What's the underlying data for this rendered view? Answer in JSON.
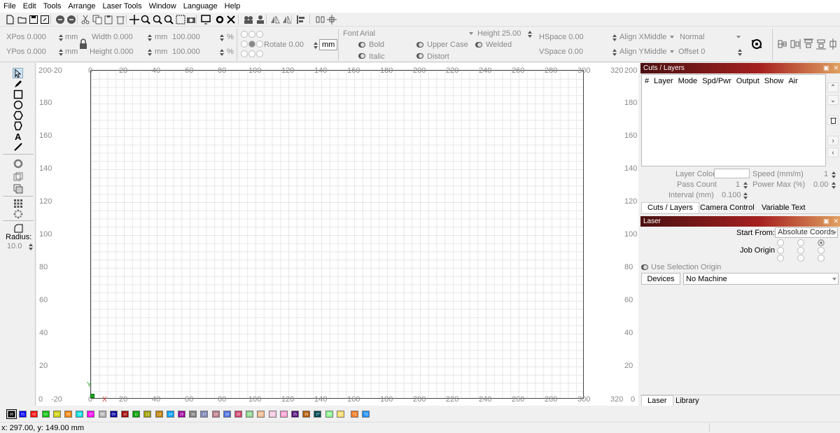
{
  "menu": [
    "File",
    "Edit",
    "Tools",
    "Arrange",
    "Laser Tools",
    "Window",
    "Language",
    "Help"
  ],
  "toolbar_icons": [
    "new-file-icon",
    "open-file-icon",
    "save-icon",
    "save-as-icon",
    "undo-icon",
    "redo-icon",
    "cut-icon",
    "copy-icon",
    "paste-icon",
    "delete-icon",
    "move-icon",
    "zoom-in-icon",
    "zoom-out-icon",
    "zoom-frame-icon",
    "zoom-fit-icon",
    "camera-icon",
    "monitor-icon",
    "settings-icon",
    "tools-icon",
    "group-icon",
    "user-icon",
    "mirror-h-icon",
    "mirror-v-icon",
    "align-icon",
    "distribute-icon",
    "center-icon"
  ],
  "props": {
    "xpos": "XPos 0.000",
    "ypos": "YPos 0.000",
    "unit_mm": "mm",
    "width": "Width 0.000",
    "height": "Height 0.000",
    "width_pct": "100.000",
    "height_pct": "100.000",
    "pct": "%",
    "rotate": "Rotate 0.00",
    "rotate_unit": "mm",
    "font_label": "Font",
    "font_value": "Arial",
    "font_height": "Height 25.00",
    "bold": "Bold",
    "italic": "Italic",
    "upper_case": "Upper Case",
    "distort": "Distort",
    "welded": "Welded",
    "hspace": "HSpace 0.00",
    "vspace": "VSpace 0.00",
    "align_x": "Align X",
    "align_x_value": "Middle",
    "align_y": "Align Y",
    "align_y_value": "Middle",
    "mode_value": "Normal",
    "offset": "Offset 0"
  },
  "left_tools": {
    "icons": [
      "select-arrow-icon",
      "pencil-icon",
      "rectangle-icon",
      "ellipse-icon",
      "polygon-icon",
      "pentagon-icon",
      "text-icon",
      "measure-icon",
      "circle-gear-icon",
      "offset-icon",
      "boolean-icon",
      "grid-array-icon",
      "circular-array-icon",
      "corner-icon"
    ],
    "radius_label": "Radius:",
    "radius_value": "10.0"
  },
  "ruler": {
    "x_top": [
      "-20",
      "0",
      "20",
      "40",
      "60",
      "80",
      "100",
      "120",
      "140",
      "160",
      "180",
      "200",
      "220",
      "240",
      "260",
      "280",
      "300",
      "320"
    ],
    "y_left": [
      "200",
      "180",
      "160",
      "140",
      "120",
      "100",
      "80",
      "60",
      "40",
      "20",
      "0"
    ],
    "corner_top_left": "200",
    "corner_top_right": "200",
    "corner_bottom_right": "0",
    "axis_x": "X",
    "axis_y": "Y"
  },
  "cuts_layers": {
    "title": "Cuts / Layers",
    "columns": [
      "#",
      "Layer",
      "Mode",
      "Spd/Pwr",
      "Output",
      "Show",
      "Air"
    ],
    "layer_color_label": "Layer Color",
    "speed_label": "Speed (mm/m)",
    "speed_value": "1",
    "pass_count_label": "Pass Count",
    "pass_count_value": "1",
    "power_max_label": "Power Max (%)",
    "power_max_value": "0.00",
    "interval_label": "Interval (mm)",
    "interval_value": "0.100",
    "tabs": [
      "Cuts / Layers",
      "Camera Control",
      "Variable Text"
    ]
  },
  "laser": {
    "title": "Laser",
    "start_from_label": "Start From:",
    "start_from_value": "Absolute Coords",
    "job_origin_label": "Job Origin",
    "use_selection_origin": "Use Selection Origin",
    "devices_button": "Devices",
    "machine_value": "No Machine",
    "tabs": [
      "Laser",
      "Library"
    ]
  },
  "palette": [
    {
      "label": "00",
      "color": "#000000"
    },
    {
      "label": "01",
      "color": "#0000ff"
    },
    {
      "label": "02",
      "color": "#ff0000"
    },
    {
      "label": "03",
      "color": "#00c000"
    },
    {
      "label": "04",
      "color": "#d0d000"
    },
    {
      "label": "05",
      "color": "#ff8000"
    },
    {
      "label": "06",
      "color": "#00e0e0"
    },
    {
      "label": "07",
      "color": "#ff00ff"
    },
    {
      "label": "08",
      "color": "#b4b4b4"
    },
    {
      "label": "09",
      "color": "#0000a0"
    },
    {
      "label": "10",
      "color": "#a00000"
    },
    {
      "label": "11",
      "color": "#00a000"
    },
    {
      "label": "12",
      "color": "#a0a000"
    },
    {
      "label": "13",
      "color": "#c08000"
    },
    {
      "label": "14",
      "color": "#00a0ff"
    },
    {
      "label": "15",
      "color": "#a000a0"
    },
    {
      "label": "16",
      "color": "#808080"
    },
    {
      "label": "17",
      "color": "#7d87b9"
    },
    {
      "label": "18",
      "color": "#bb7784"
    },
    {
      "label": "19",
      "color": "#4a6fe3"
    },
    {
      "label": "20",
      "color": "#d33f6a"
    },
    {
      "label": "21",
      "color": "#8cd78c"
    },
    {
      "label": "22",
      "color": "#f0b98d"
    },
    {
      "label": "23",
      "color": "#f6c4e1"
    },
    {
      "label": "24",
      "color": "#fa9ed4"
    },
    {
      "label": "25",
      "color": "#500a78"
    },
    {
      "label": "26",
      "color": "#b45a00"
    },
    {
      "label": "27",
      "color": "#004754"
    },
    {
      "label": "28",
      "color": "#86fa88"
    },
    {
      "label": "29",
      "color": "#ffdb66"
    },
    {
      "label": "T1",
      "color": "#f37b21"
    },
    {
      "label": "T2",
      "color": "#1e90ff"
    }
  ],
  "status": "x: 297.00, y: 149.00 mm"
}
